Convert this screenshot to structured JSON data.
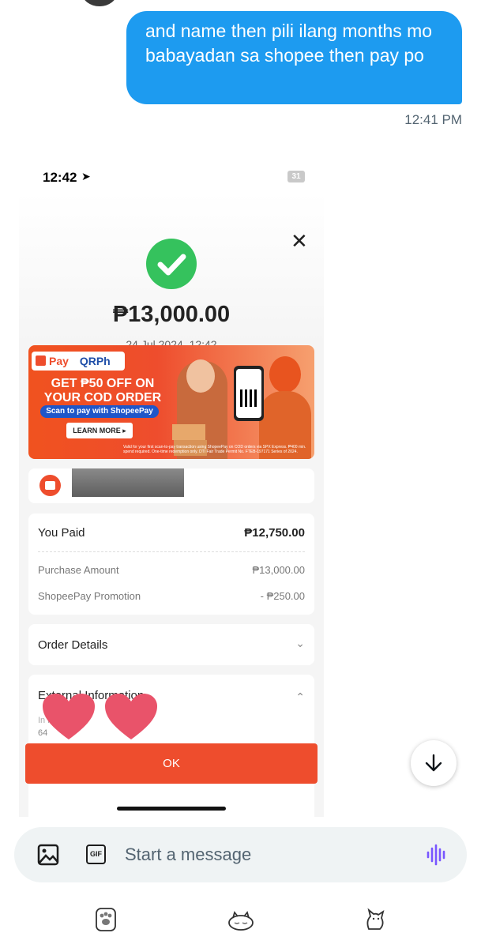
{
  "message": {
    "text": "and name then pili ilang months mo babayadan sa shopee then pay po",
    "time": "12:41 PM"
  },
  "receipt": {
    "status_time": "12:42",
    "battery": "31",
    "amount": "₱13,000.00",
    "date": "24 Jul 2024, 12:42",
    "banner": {
      "brand_pay": "Pay",
      "brand_qr": "QRPh",
      "headline": "GET ₱50 OFF ON YOUR COD ORDER",
      "scan": "Scan to pay with ShopeePay",
      "learn_more": "LEARN MORE ▸",
      "fine_print": "Valid for your first scan-to-pay transaction using ShopeePay on COD orders via SPX Express. ₱400 min. spend required. One-time redemption only. DTI Fair Trade Permit No. FTEB-197171 Series of 2024."
    },
    "paid": {
      "label": "You Paid",
      "value": "₱12,750.00",
      "rows": [
        {
          "label": "Purchase Amount",
          "value": "₱13,000.00"
        },
        {
          "label": "ShopeePay Promotion",
          "value": "- ₱250.00"
        }
      ]
    },
    "order_details": "Order Details",
    "external_info": "External Information",
    "external_sub": "In          re",
    "external_sub2": "64",
    "ok": "OK"
  },
  "composer": {
    "placeholder": "Start a message"
  },
  "colors": {
    "bubble": "#1d9bf0",
    "shopee_orange": "#ee4d2d",
    "success_green": "#35c25d",
    "heart": "#e9536a",
    "voice": "#7856ff"
  }
}
